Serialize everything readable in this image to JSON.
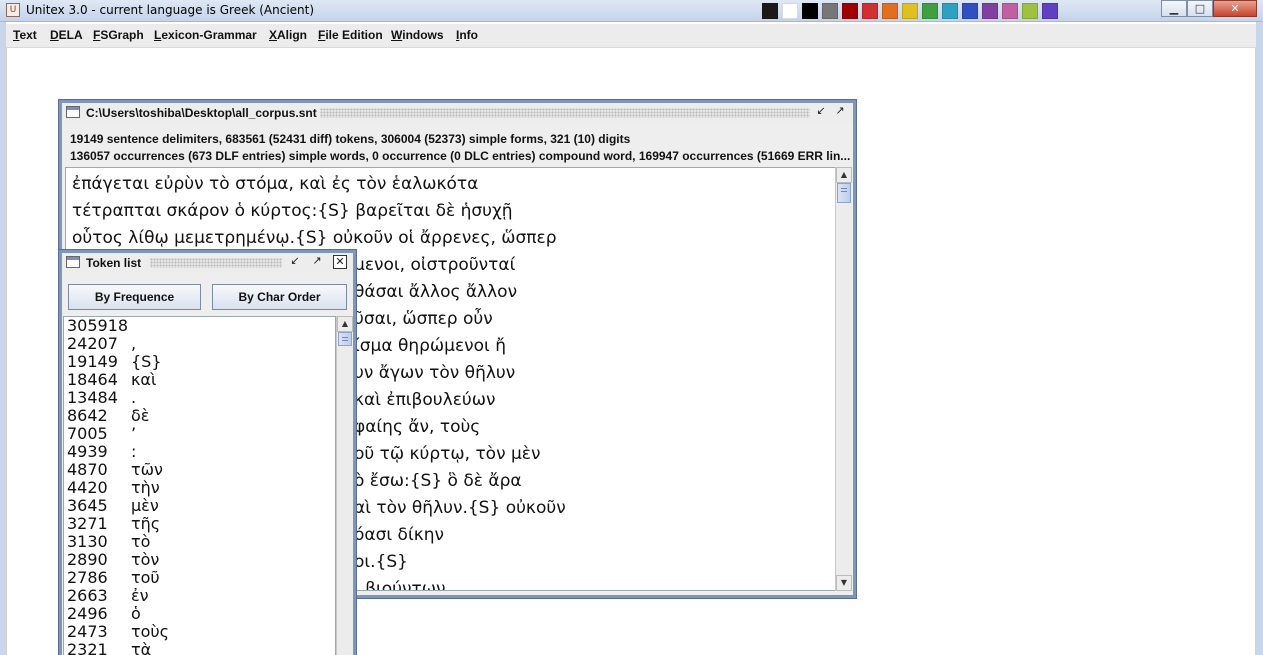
{
  "app": {
    "title": "Unitex 3.0 - current language is Greek (Ancient)",
    "icon": "unitex-app-icon",
    "window_controls": [
      "minimize",
      "maximize",
      "close"
    ]
  },
  "menu": [
    "Text",
    "DELA",
    "FSGraph",
    "Lexicon-Grammar",
    "XAlign",
    "File Edition",
    "Windows",
    "Info"
  ],
  "corpus_window": {
    "title": "C:\\Users\\toshiba\\Desktop\\all_corpus.snt",
    "stats_line1": "19149 sentence delimiters, 683561 (52431 diff) tokens, 306004 (52373) simple forms, 321 (10) digits",
    "stats_line2": "136057 occurrences (673 DLF entries) simple words, 0 occurrence (0 DLC entries) compound word, 169947 occurrences (51669 ERR lin...",
    "lines": [
      "ἐπάγεται εὐρὺν τὸ στόμα, καὶ ἐς τὸν ἑαλωκότα",
      "τέτραπται σκάρον ὁ κύρτος:{S} βαρεῖται δὲ ἡσυχῇ",
      "οὗτος λίθῳ μεμετρημένῳ.{S} οὐκοῦν οἱ ἄρρενες, ὥσπερ",
      "μενοι, οἰστροῦνταί",
      "θάσαι ἄλλος ἄλλον",
      "ῦσαι, ὥσπερ οὖν",
      "ίσμα θηρώμενοι ἤ",
      "υν ἄγων τὸν θῆλυν",
      "καὶ ἐπιβουλεύων",
      "φαίης ἄν, τοὺς",
      "οῦ τῷ κύρτῳ, τὸν μὲν",
      "ὸ ἔσω:{S} ὃ δὲ ἄρα",
      "αὶ τὸν θῆλυν.{S} οὐκοῦν",
      "όασι δίκην",
      "οι.{S}",
      "ι βιούντων"
    ]
  },
  "token_window": {
    "title": "Token list",
    "by_frequence": "By Frequence",
    "by_char_order": "By Char Order",
    "rows": [
      {
        "count": "305918",
        "token": ""
      },
      {
        "count": "24207",
        "token": ","
      },
      {
        "count": "19149",
        "token": "{S}"
      },
      {
        "count": "18464",
        "token": "καὶ"
      },
      {
        "count": "13484",
        "token": "."
      },
      {
        "count": "8642",
        "token": "δὲ"
      },
      {
        "count": "7005",
        "token": "’"
      },
      {
        "count": "4939",
        "token": ":"
      },
      {
        "count": "4870",
        "token": "τῶν"
      },
      {
        "count": "4420",
        "token": "τὴν"
      },
      {
        "count": "3645",
        "token": "μὲν"
      },
      {
        "count": "3271",
        "token": "τῆς"
      },
      {
        "count": "3130",
        "token": "τὸ"
      },
      {
        "count": "2890",
        "token": "τὸν"
      },
      {
        "count": "2786",
        "token": "τοῦ"
      },
      {
        "count": "2663",
        "token": "ἐν"
      },
      {
        "count": "2496",
        "token": "ὁ"
      },
      {
        "count": "2473",
        "token": "τοὺς"
      },
      {
        "count": "2321",
        "token": "τὰ"
      }
    ]
  },
  "colors": {
    "frame_border": "#7f95bc",
    "scroll_thumb": "#bcccea"
  }
}
